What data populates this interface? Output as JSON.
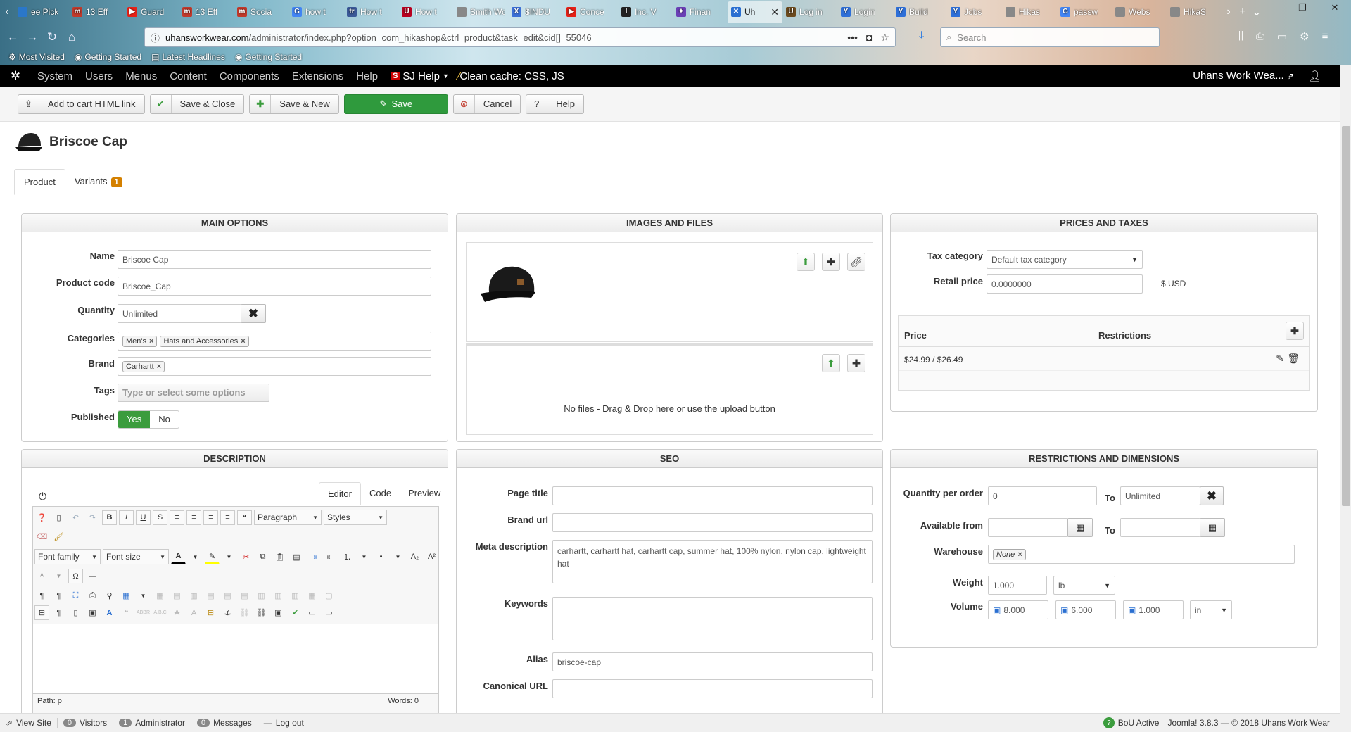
{
  "browser": {
    "tabs": [
      {
        "label": "ee Pick",
        "fav": "#2a77c9",
        "glyph": ""
      },
      {
        "label": "13 Eff",
        "fav": "#c0392b",
        "glyph": "m"
      },
      {
        "label": "Guard",
        "fav": "#e62117",
        "glyph": "▶"
      },
      {
        "label": "13 Eff",
        "fav": "#c0392b",
        "glyph": "m"
      },
      {
        "label": "Socia",
        "fav": "#c0392b",
        "glyph": "m"
      },
      {
        "label": "how t",
        "fav": "#4285f4",
        "glyph": "G"
      },
      {
        "label": "How t",
        "fav": "#3b5998",
        "glyph": "tr"
      },
      {
        "label": "How t",
        "fav": "#b8001f",
        "glyph": "U"
      },
      {
        "label": "Smith Wo",
        "fav": "#888888",
        "glyph": ""
      },
      {
        "label": "$INDU",
        "fav": "#3b6fd6",
        "glyph": "X"
      },
      {
        "label": "Conce",
        "fav": "#e62117",
        "glyph": "▶"
      },
      {
        "label": "Inc. V",
        "fav": "#222222",
        "glyph": "I"
      },
      {
        "label": "Finan",
        "fav": "#6a3fb5",
        "glyph": "✦"
      },
      {
        "label": "Uh",
        "fav": "#2a6fd1",
        "glyph": "✕",
        "active": true
      },
      {
        "label": "Log in",
        "fav": "#6b4a1e",
        "glyph": "U"
      },
      {
        "label": "Login",
        "fav": "#2e6fd8",
        "glyph": "Y"
      },
      {
        "label": "Build",
        "fav": "#2e6fd8",
        "glyph": "Y"
      },
      {
        "label": "Jobs",
        "fav": "#2e6fd8",
        "glyph": "Y"
      },
      {
        "label": "Hikas",
        "fav": "#888888",
        "glyph": ""
      },
      {
        "label": "passw",
        "fav": "#4285f4",
        "glyph": "G"
      },
      {
        "label": "Webs",
        "fav": "#888888",
        "glyph": ""
      },
      {
        "label": "HikaS",
        "fav": "#888888",
        "glyph": ""
      }
    ],
    "url_domain": "uhansworkwear.com",
    "url_path": "/administrator/index.php?option=com_hikashop&ctrl=product&task=edit&cid[]=55046",
    "search_placeholder": "Search",
    "bookmarks": [
      "Most Visited",
      "Getting Started",
      "Latest Headlines",
      "Getting Started"
    ]
  },
  "joomla_menu": {
    "items": [
      "System",
      "Users",
      "Menus",
      "Content",
      "Components",
      "Extensions",
      "Help"
    ],
    "sj_help": "SJ Help",
    "clean_cache": "Clean cache: CSS, JS",
    "site_name": "Uhans Work Wea..."
  },
  "toolbar": {
    "add_cart": "Add to cart HTML link",
    "save_close": "Save & Close",
    "save_new": "Save & New",
    "save": "Save",
    "cancel": "Cancel",
    "help": "Help"
  },
  "page": {
    "title": "Briscoe Cap",
    "tab_product": "Product",
    "tab_variants": "Variants",
    "variants_count": "1"
  },
  "main_options": {
    "header": "MAIN OPTIONS",
    "name_label": "Name",
    "name_value": "Briscoe Cap",
    "code_label": "Product code",
    "code_value": "Briscoe_Cap",
    "qty_label": "Quantity",
    "qty_value": "Unlimited",
    "cat_label": "Categories",
    "categories": [
      "Men's",
      "Hats and Accessories"
    ],
    "brand_label": "Brand",
    "brand_value": "Carhartt",
    "tags_label": "Tags",
    "tags_placeholder": "Type or select some options",
    "pub_label": "Published",
    "pub_yes": "Yes",
    "pub_no": "No"
  },
  "images": {
    "header": "IMAGES AND FILES",
    "no_files": "No files - Drag & Drop here or use the upload button"
  },
  "prices": {
    "header": "PRICES AND TAXES",
    "tax_label": "Tax category",
    "tax_value": "Default tax category",
    "retail_label": "Retail price",
    "retail_value": "0.0000000",
    "currency": "$ USD",
    "col_price": "Price",
    "col_restrictions": "Restrictions",
    "price_row": "$24.99 / $26.49"
  },
  "description": {
    "header": "DESCRIPTION",
    "tab_editor": "Editor",
    "tab_code": "Code",
    "tab_preview": "Preview",
    "paragraph": "Paragraph",
    "styles": "Styles",
    "font_family": "Font family",
    "font_size": "Font size",
    "path": "Path: p",
    "words": "Words: 0"
  },
  "seo": {
    "header": "SEO",
    "page_title_label": "Page title",
    "brand_url_label": "Brand url",
    "meta_label": "Meta description",
    "meta_value": "carhartt, carhartt hat, carhartt cap, summer hat, 100% nylon, nylon cap, lightweight hat",
    "keywords_label": "Keywords",
    "alias_label": "Alias",
    "alias_value": "briscoe-cap",
    "canonical_label": "Canonical URL"
  },
  "restrictions": {
    "header": "RESTRICTIONS AND DIMENSIONS",
    "qpo_label": "Quantity per order",
    "qpo_from": "0",
    "to": "To",
    "qpo_to": "Unlimited",
    "avail_label": "Available from",
    "warehouse_label": "Warehouse",
    "warehouse_value": "None",
    "weight_label": "Weight",
    "weight_value": "1.000",
    "weight_unit": "lb",
    "volume_label": "Volume",
    "vol_l": "8.000",
    "vol_w": "6.000",
    "vol_h": "1.000",
    "vol_unit": "in"
  },
  "footer": {
    "view_site": "View Site",
    "visitors_count": "0",
    "visitors": "Visitors",
    "admin_count": "1",
    "admin": "Administrator",
    "msg_count": "0",
    "messages": "Messages",
    "logout": "Log out",
    "bou": "BoU Active",
    "version": "Joomla! 3.8.3 — © 2018 Uhans Work Wear"
  }
}
